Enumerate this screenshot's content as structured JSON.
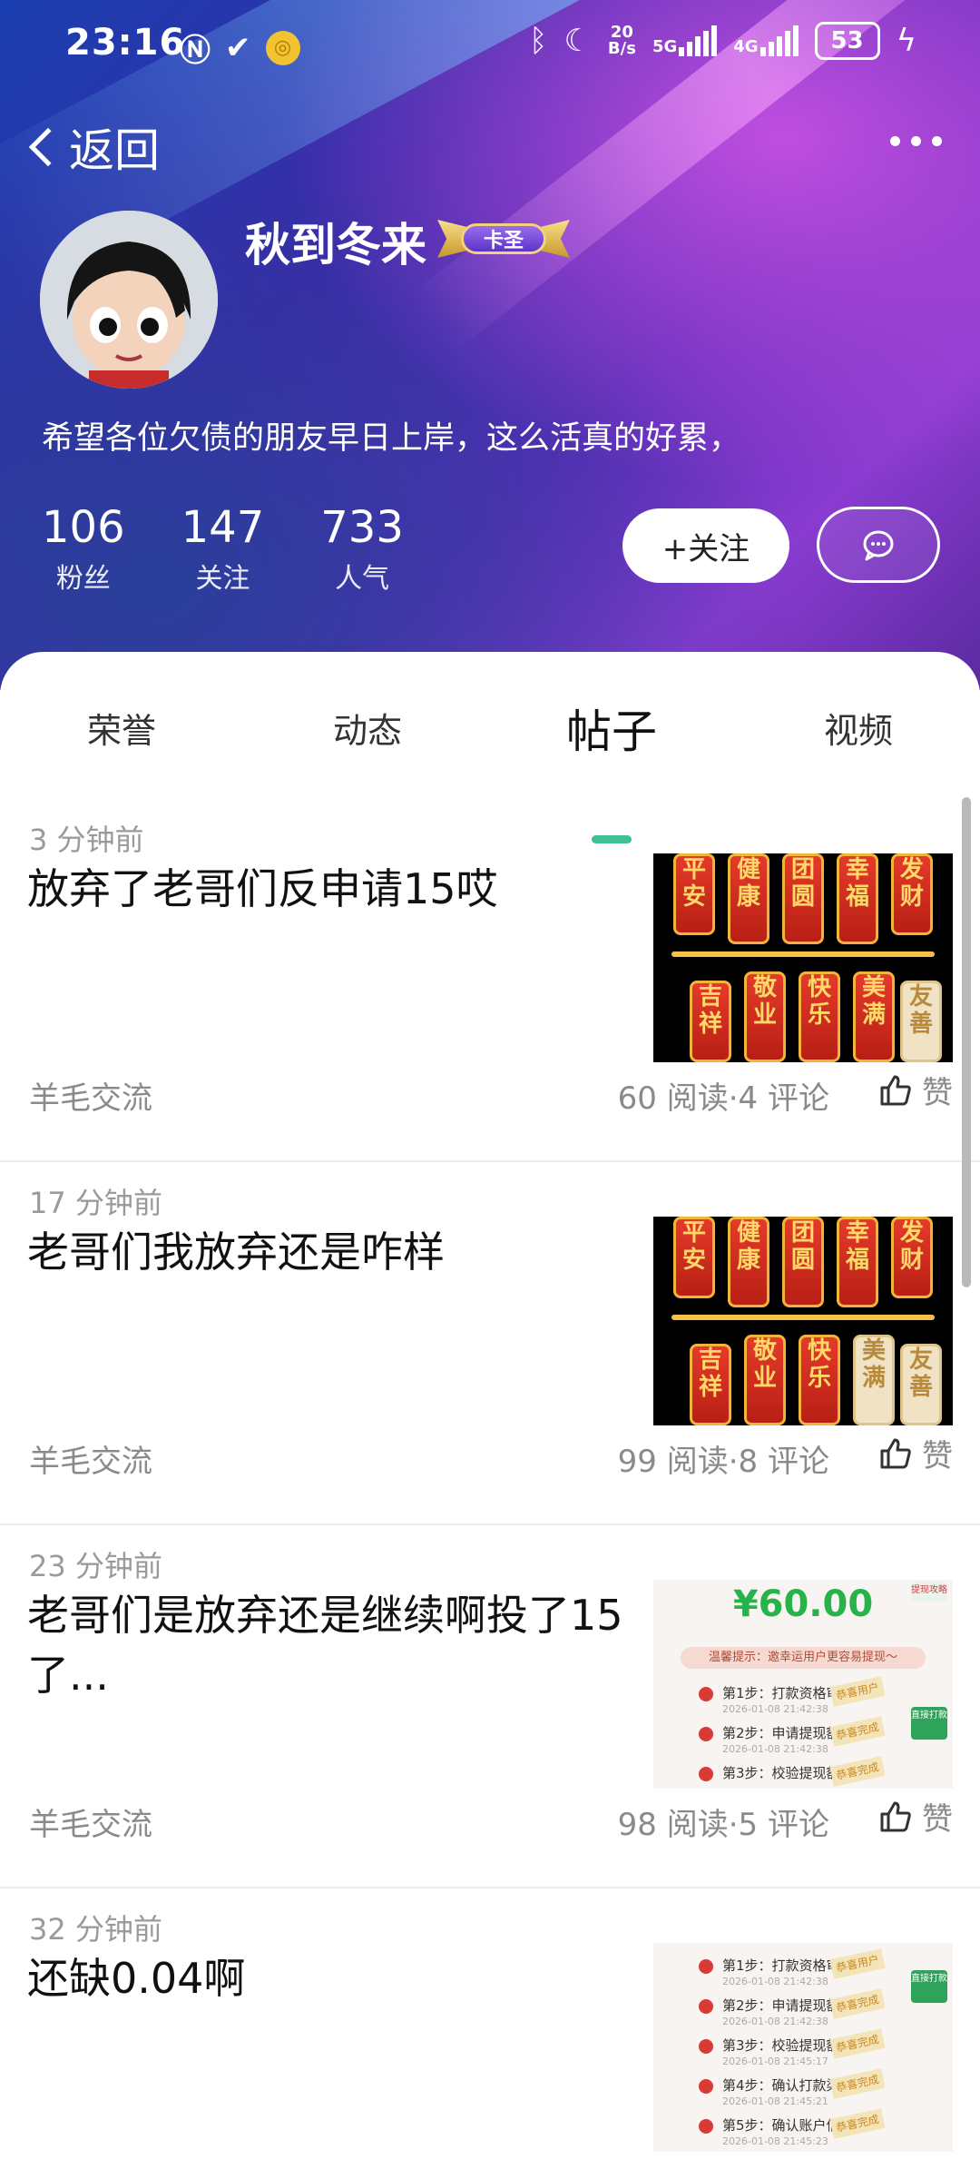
{
  "status_bar": {
    "time": "23:16",
    "speed_top": "20",
    "speed_bottom": "B/s",
    "net1": "5G",
    "net2": "4G",
    "battery": "53"
  },
  "nav": {
    "back_label": "返回"
  },
  "profile": {
    "name": "秋到冬来",
    "badge": "卡圣",
    "bio": "希望各位欠债的朋友早日上岸，这么活真的好累，",
    "stats": [
      {
        "value": "106",
        "label": "粉丝"
      },
      {
        "value": "147",
        "label": "关注"
      },
      {
        "value": "733",
        "label": "人气"
      }
    ],
    "follow_label": "+关注"
  },
  "tabs": [
    {
      "label": "荣誉",
      "active": false
    },
    {
      "label": "动态",
      "active": false
    },
    {
      "label": "帖子",
      "active": true
    },
    {
      "label": "视频",
      "active": false
    }
  ],
  "posts": [
    {
      "time": "3 分钟前",
      "title": "放弃了老哥们反申请15哎",
      "category": "羊毛交流",
      "stats": "60 阅读·4 评论",
      "like_label": "赞",
      "thumb": "lanterns"
    },
    {
      "time": "17 分钟前",
      "title": "老哥们我放弃还是咋样",
      "category": "羊毛交流",
      "stats": "99 阅读·8 评论",
      "like_label": "赞",
      "thumb": "lanterns"
    },
    {
      "time": "23 分钟前",
      "title": "老哥们是放弃还是继续啊投了15了...",
      "category": "羊毛交流",
      "stats": "98 阅读·5 评论",
      "like_label": "赞",
      "thumb": "withdraw"
    },
    {
      "time": "32 分钟前",
      "title": "还缺0.04啊",
      "category": "",
      "stats": "",
      "like_label": "",
      "thumb": "steps"
    }
  ],
  "lantern_text": {
    "top": [
      "平安",
      "健康",
      "团圆",
      "幸福",
      "发财"
    ],
    "bottom": [
      "吉祥",
      "敬业",
      "快乐",
      "美满",
      "友善"
    ]
  },
  "withdraw_thumb": {
    "amount": "¥60.00",
    "tip": "温馨提示：邀幸运用户更容易提现～",
    "steps": [
      {
        "label": "第1步：打款资格审核",
        "time": "2026-01-08 21:42:38",
        "stamp": "恭喜用户"
      },
      {
        "label": "第2步：申请提现额度",
        "time": "2026-01-08 21:42:38",
        "stamp": "恭喜完成"
      },
      {
        "label": "第3步：校验提现额度",
        "time": "2026-01-08 21:45:17",
        "stamp": "恭喜完成"
      },
      {
        "label": "第4步：确认打款渠道",
        "time": "2026-01-08 21:45:21",
        "stamp": "恭喜完成"
      },
      {
        "label": "第5步：确认账户信息",
        "time": "2026-01-08 21:45:23",
        "stamp": "恭喜完成"
      }
    ],
    "tag": "直接打款",
    "tag2": "提现攻略"
  },
  "colors": {
    "accent": "#3fbf96",
    "hero_from": "#1a3fb0",
    "hero_to": "#8a3bd0"
  }
}
